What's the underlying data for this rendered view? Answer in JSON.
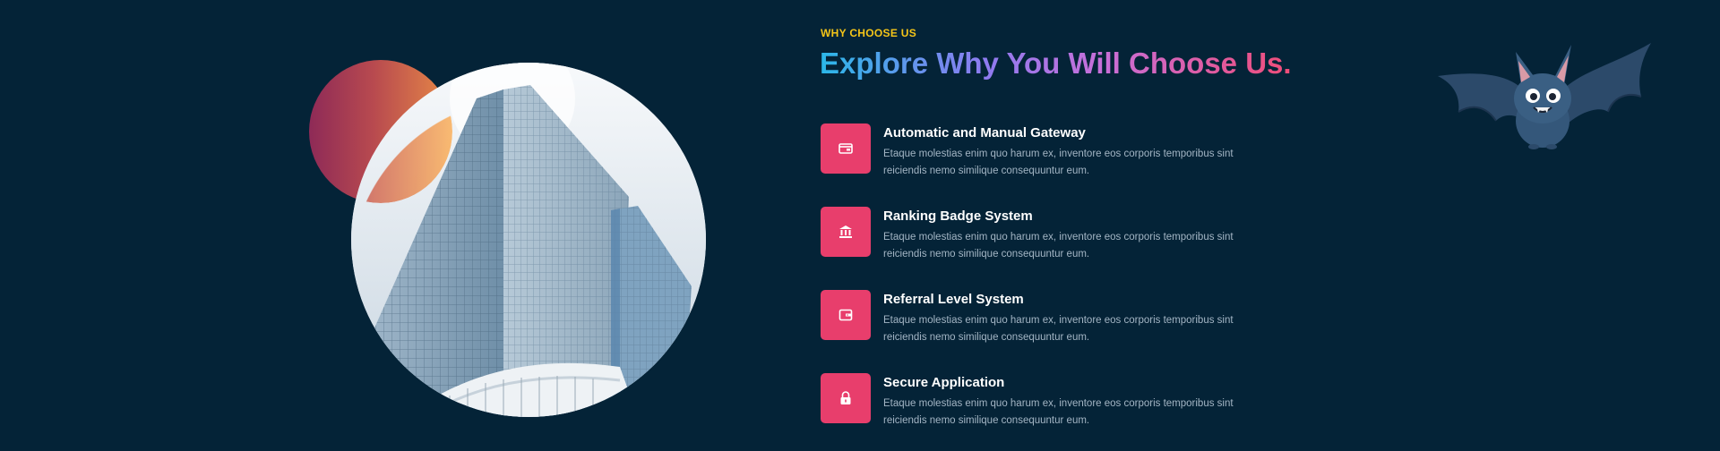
{
  "section": {
    "kicker": "WHY CHOOSE US",
    "headline": "Explore Why You Will Choose Us."
  },
  "features": [
    {
      "icon": "wallet-icon",
      "title": "Automatic and Manual Gateway",
      "description": "Etaque molestias enim quo harum ex, inventore eos corporis temporibus sint reiciendis nemo similique consequuntur eum."
    },
    {
      "icon": "bank-icon",
      "title": "Ranking Badge System",
      "description": "Etaque molestias enim quo harum ex, inventore eos corporis temporibus sint reiciendis nemo similique consequuntur eum."
    },
    {
      "icon": "wallet-alt-icon",
      "title": "Referral Level System",
      "description": "Etaque molestias enim quo harum ex, inventore eos corporis temporibus sint reiciendis nemo similique consequuntur eum."
    },
    {
      "icon": "lock-icon",
      "title": "Secure Application",
      "description": "Etaque molestias enim quo harum ex, inventore eos corporis temporibus sint reiciendis nemo similique consequuntur eum."
    }
  ],
  "colors": {
    "background": "#042337",
    "accent": "#e83e6c",
    "kicker": "#f5c518",
    "headline_gradient": [
      "#2bb7e8",
      "#8e7bf0",
      "#c86fd8",
      "#f04d78"
    ]
  }
}
